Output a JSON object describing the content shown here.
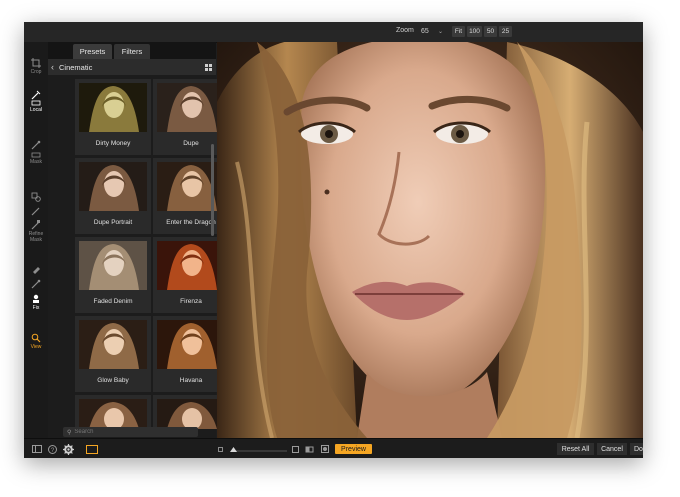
{
  "toolbar": {
    "zoom_label": "Zoom",
    "zoom_value": "65",
    "zoom_presets": [
      "Fit",
      "100",
      "50",
      "25"
    ]
  },
  "tools": [
    {
      "label": "Crop",
      "icon": "crop-icon"
    },
    {
      "label": "Local",
      "icon": "local-adjust-icon"
    },
    {
      "label": "Mask",
      "icon": "mask-brush-icon"
    },
    {
      "label": "Refine Mask",
      "icon": "refine-mask-icon"
    },
    {
      "label": "Fix",
      "icon": "fix-stamp-icon"
    },
    {
      "label": "View",
      "icon": "view-zoom-icon"
    }
  ],
  "panel": {
    "tabs": [
      "Presets",
      "Filters"
    ],
    "category": "Cinematic",
    "presets": [
      "Dirty Money",
      "Dupe",
      "Dupe Portrait",
      "Enter the Dragon",
      "Faded Denim",
      "Firenza",
      "Glow Baby",
      "Havana"
    ],
    "search_placeholder": "Search"
  },
  "bottom": {
    "preview_label": "Preview",
    "reset_label": "Reset All",
    "cancel_label": "Cancel",
    "done_label": "Done"
  },
  "colors": {
    "accent": "#f5a623",
    "panel_bg": "#1c1c1c",
    "toolbar_bg": "#262626"
  }
}
